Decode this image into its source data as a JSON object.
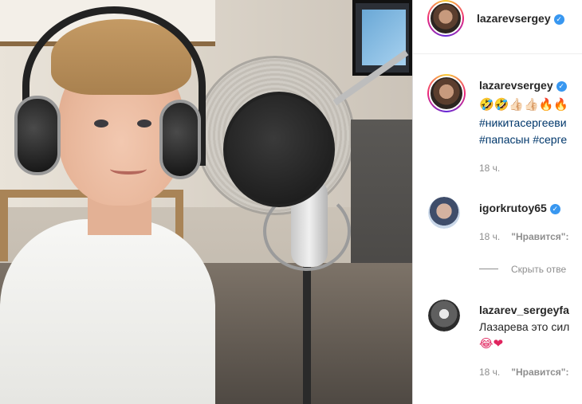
{
  "post": {
    "photo_alt": "boy with headphones at a studio microphone",
    "author": {
      "username": "lazarevsergey",
      "verified_icon": "verified-badge-icon"
    }
  },
  "comments": [
    {
      "username": "lazarevsergey",
      "verified": true,
      "lines": [
        {
          "emoji": "🤣🤣👍🏻👍🏻🔥🔥"
        },
        {
          "hashtags": "#никитасергееви"
        },
        {
          "hashtags": "#папасын #серге"
        }
      ],
      "time": "18 ч."
    },
    {
      "username": "igorkrutoy65",
      "verified": true,
      "time": "18 ч.",
      "like_label": "\"Нравится\":"
    },
    {
      "username": "lazarev_sergeyfa",
      "verified": false,
      "text": "Лазарева это сил",
      "emoji": "😂❤",
      "time": "18 ч.",
      "like_label": "\"Нравится\":"
    }
  ],
  "hide_replies_label": "Скрыть отве",
  "colors": {
    "verified_blue": "#3897f0",
    "hashtag": "#00376b",
    "meta_gray": "#8e8e8e",
    "heart": "#e0245e"
  }
}
